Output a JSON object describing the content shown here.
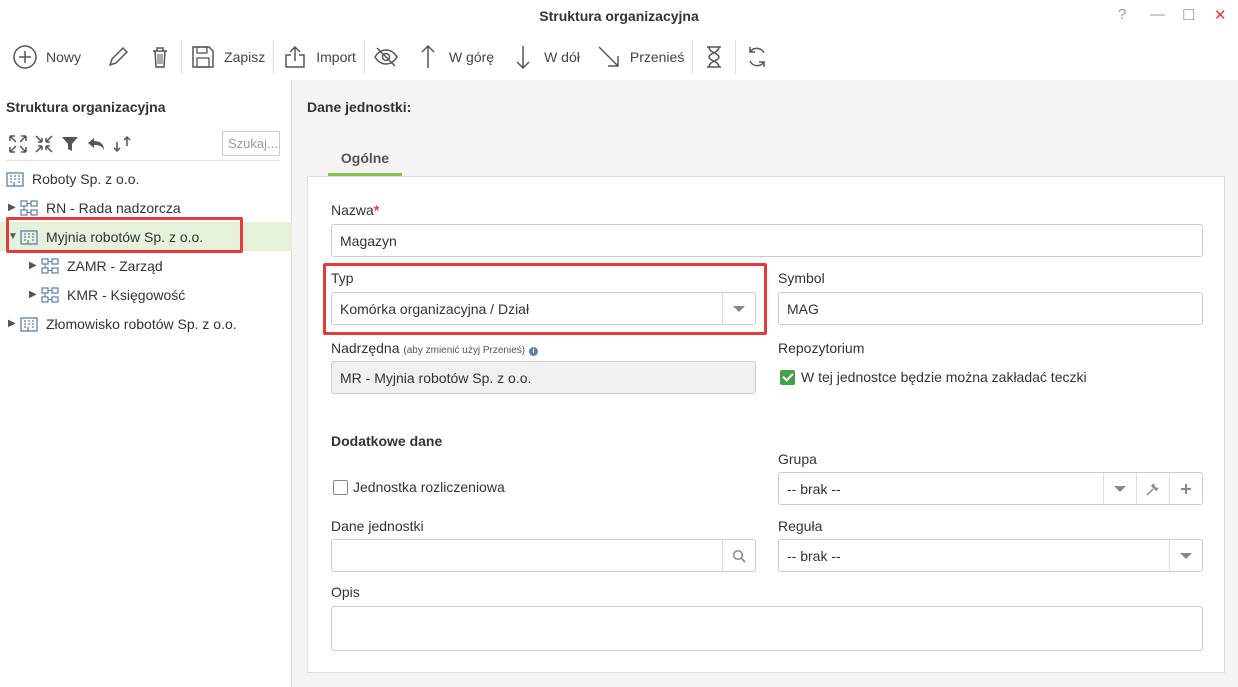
{
  "window": {
    "title": "Struktura organizacyjna",
    "help": "?",
    "minimize": "—",
    "maximize": "☐",
    "close": "✕"
  },
  "toolbar": {
    "new_label": "Nowy",
    "save_label": "Zapisz",
    "import_label": "Import",
    "up_label": "W górę",
    "down_label": "W dół",
    "move_label": "Przenieś"
  },
  "left": {
    "title": "Struktura organizacyjna",
    "search_placeholder": "Szukaj...",
    "tree": [
      {
        "label": "Roboty Sp. z o.o."
      },
      {
        "label": "RN - Rada nadzorcza"
      },
      {
        "label": "Myjnia robotów Sp. z o.o."
      },
      {
        "label": "ZAMR - Zarząd"
      },
      {
        "label": "KMR - Księgowość"
      },
      {
        "label": "Złomowisko robotów Sp. z o.o."
      }
    ]
  },
  "main": {
    "heading": "Dane jednostki:",
    "tab": "Ogólne",
    "nazwa_label": "Nazwa",
    "nazwa_required": "*",
    "nazwa_value": "Magazyn",
    "typ_label": "Typ",
    "typ_value": "Komórka organizacyjna / Dział",
    "symbol_label": "Symbol",
    "symbol_value": "MAG",
    "nadrzedna_label": "Nadrzędna",
    "nadrzedna_hint": "(aby zmienić użyj Przenieś)",
    "nadrzedna_info": "i",
    "nadrzedna_value": "MR - Myjnia robotów Sp. z o.o.",
    "repo_label": "Repozytorium",
    "repo_checkbox": "W tej jednostce będzie można zakładać teczki",
    "repo_checked": true,
    "extra_heading": "Dodatkowe dane",
    "grupa_label": "Grupa",
    "grupa_value": "-- brak --",
    "rozliczeniowa_label": "Jednostka rozliczeniowa",
    "rozliczeniowa_checked": false,
    "dane_label": "Dane jednostki",
    "dane_value": "",
    "regula_label": "Reguła",
    "regula_value": "-- brak --",
    "opis_label": "Opis",
    "opis_value": ""
  },
  "colors": {
    "accent": "#8bc34a",
    "highlight": "#e03c3c",
    "selected_bg": "#e6f1dc",
    "check": "#43a047",
    "icon_blue": "#5b7fa6"
  }
}
